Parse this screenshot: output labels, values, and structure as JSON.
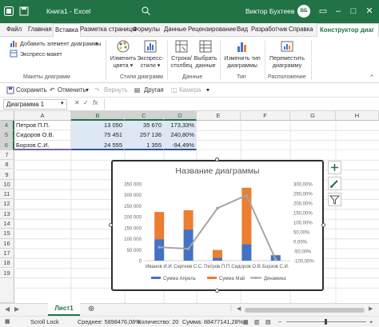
{
  "titlebar": {
    "title": "Книга1 - Excel",
    "user": "Виктор Бухтеев",
    "user_initials": "ВБ",
    "colors": {
      "excel_green": "#217346"
    }
  },
  "ribbon_tabs": [
    "Файл",
    "Главная",
    "Вставка",
    "Разметка страницы",
    "Формулы",
    "Данные",
    "Рецензирование",
    "Вид",
    "Разработчик",
    "Справка",
    "Конструктор диаг"
  ],
  "ribbon": {
    "add_element": "Добавить элемент диаграммы",
    "express_layout": "Экспресс-макет",
    "group_layouts": "Макеты диаграмм",
    "change_colors_1": "Изменить",
    "change_colors_2": "цвета",
    "express_styles_1": "Экспресс-",
    "express_styles_2": "стили",
    "group_styles": "Стили диаграмм",
    "row_col_1": "Строка/",
    "row_col_2": "столбец",
    "select_data_1": "Выбрать",
    "select_data_2": "данные",
    "group_data": "Данные",
    "change_type_1": "Изменить тип",
    "change_type_2": "диаграммы",
    "group_type": "Тип",
    "move_chart_1": "Переместить",
    "move_chart_2": "диаграмму",
    "group_location": "Расположение"
  },
  "qat": {
    "save": "Сохранить",
    "undo": "Отменить",
    "redo": "Вернуть",
    "other": "Другая",
    "camera": "Камера"
  },
  "formula_bar": {
    "name_box": "Диаграмма 1",
    "fx": "fx",
    "formula": ""
  },
  "columns": [
    "A",
    "B",
    "C",
    "D",
    "E",
    "F",
    "G",
    "H"
  ],
  "rows": [
    {
      "n": "4",
      "a": "Петров П.П.",
      "b": "13 050",
      "c": "35 670",
      "d": "173,33%"
    },
    {
      "n": "5",
      "a": "Сидоров О.В.",
      "b": "75 451",
      "c": "257 136",
      "d": "240,80%"
    },
    {
      "n": "6",
      "a": "Борзов С.И.",
      "b": "24 555",
      "c": "1 355",
      "d": "-94,49%"
    }
  ],
  "empty_rows": [
    "7",
    "8",
    "9",
    "10",
    "11",
    "12",
    "13",
    "14",
    "15",
    "16",
    "17",
    "18",
    "19"
  ],
  "chart_data": {
    "type": "bar",
    "title": "Название диаграммы",
    "categories": [
      "Иванов И.И.",
      "Сергеев С.С.",
      "Петров П.П.",
      "Сидоров О.В.",
      "Борзов С.И."
    ],
    "series": [
      {
        "name": "Сумма Апрель",
        "type": "bar",
        "color": "#4472c4",
        "values": [
          98000,
          142000,
          13050,
          75451,
          24555
        ]
      },
      {
        "name": "Сумма Май",
        "type": "bar",
        "color": "#ed7d31",
        "values": [
          124000,
          88000,
          35670,
          257136,
          1355
        ]
      },
      {
        "name": "Динамика",
        "type": "line",
        "axis": "secondary",
        "color": "#a5a5a5",
        "values": [
          -0.3,
          -0.38,
          1.7333,
          2.408,
          -0.9449
        ]
      }
    ],
    "y_axis": {
      "min": 0,
      "max": 350000,
      "ticks": [
        "0",
        "50 000",
        "100 000",
        "150 000",
        "200 000",
        "250 000",
        "300 000",
        "350 000"
      ]
    },
    "y2_axis": {
      "min": -1.0,
      "max": 3.0,
      "ticks": [
        "-100,00%",
        "-50,00%",
        "0,00%",
        "50,00%",
        "100,00%",
        "150,00%",
        "200,00%",
        "250,00%",
        "300,00%"
      ]
    },
    "legend": "bottom",
    "grid": false
  },
  "sheet_tab": "Лист1",
  "status": {
    "scroll_lock": "Scroll Lock",
    "average": "Среднее: 5898476,08%",
    "count": "Количество: 20",
    "sum": "Сумма: 88477141,28%",
    "zoom": "+"
  }
}
